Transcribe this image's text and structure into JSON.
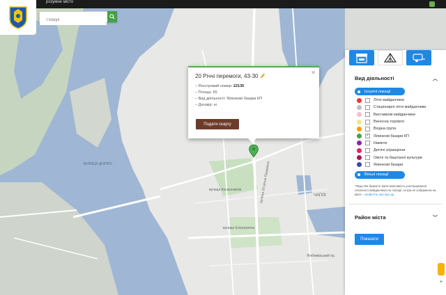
{
  "header": {
    "logo_caption": "розумне місто",
    "search_placeholder": "Пошук"
  },
  "map": {
    "labels": {
      "dnipro": "ВУЛИЦЯ ДНІПРО",
      "kosmonavtiv": "вулиця Космонавтів",
      "electrychna": "вулиця Електрична",
      "rychni": "вулиця 20-річчя Перемоги",
      "chapli": "ЧАПЛІ",
      "lyubymivskyi": "Любимівський пр."
    },
    "marker_color": "#4caf50"
  },
  "popup": {
    "title": "20 Річчі перемоги, 43-30",
    "rows": [
      {
        "label": "– Реєстровий номер:",
        "value": "22135"
      },
      {
        "label": "– Площа:",
        "value": "65"
      },
      {
        "label": "– Вид діяльності:",
        "value": "Ялинкові базари КП"
      },
      {
        "label": "– Договір:",
        "value": "ні"
      }
    ],
    "button_label": "Подати скаргу"
  },
  "panel": {
    "tabs": [
      {
        "icon": "kiosk-icon",
        "active": true
      },
      {
        "icon": "tent-icon",
        "active": false
      },
      {
        "icon": "trailer-icon",
        "active": true
      }
    ],
    "activity_title": "Вид діяльності",
    "existing_label": "Існуючі локації",
    "categories": [
      {
        "label": "Літні майданчики",
        "color": "#e53935",
        "checked": false
      },
      {
        "label": "Стаціонарні літні майданчики",
        "color": "#bdbdbd",
        "checked": false
      },
      {
        "label": "Виставкові майданчики",
        "color": "#f8bbd0",
        "checked": false
      },
      {
        "label": "Виносна торгівля",
        "color": "#f0e68c",
        "checked": false
      },
      {
        "label": "Вхідна група",
        "color": "#ff9800",
        "checked": false
      },
      {
        "label": "Ялинкові базари КП",
        "color": "#43a047",
        "checked": true
      },
      {
        "label": "Намети",
        "color": "#8e24aa",
        "checked": false
      },
      {
        "label": "Дитячі атракціони",
        "color": "#e91e63",
        "checked": false
      },
      {
        "label": "Овочі та баштанні культури",
        "color": "#ad1457",
        "checked": false
      },
      {
        "label": "Ялинкові базари",
        "color": "#3949ab",
        "checked": false
      }
    ],
    "free_label": "Вільні локації",
    "note_text": "*Якщо Ви бажаєте мати можливість розташування сезонного майданчика на локації, котра не зображена на мапі –",
    "note_link": "сповістіть нас про це",
    "district_title": "Район міста",
    "show_button": "Показати"
  }
}
